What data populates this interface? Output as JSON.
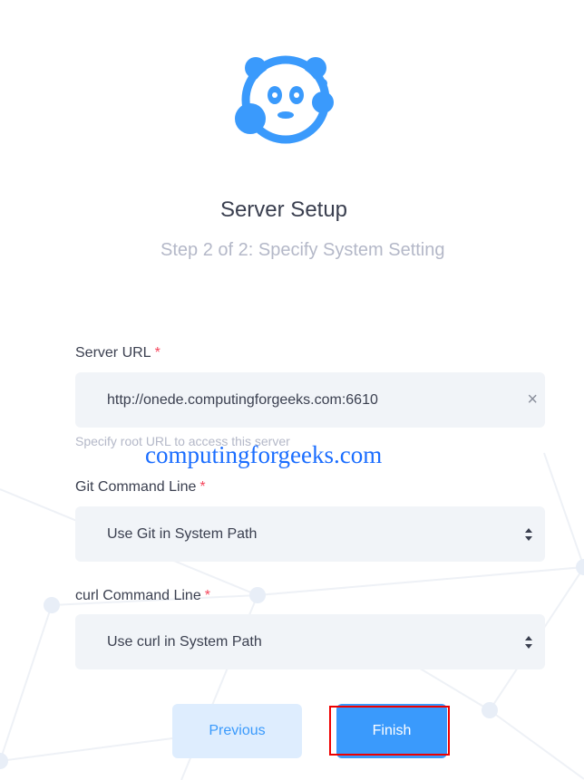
{
  "header": {
    "title": "Server Setup",
    "subtitle": "Step 2 of 2: Specify System Setting"
  },
  "form": {
    "server_url": {
      "label": "Server URL",
      "required_mark": "*",
      "value": "http://onede.computingforgeeks.com:6610",
      "hint": "Specify root URL to access this server",
      "clear_icon": "×"
    },
    "git": {
      "label": "Git Command Line",
      "required_mark": "*",
      "value": "Use Git in System Path"
    },
    "curl": {
      "label": "curl Command Line",
      "required_mark": "*",
      "value": "Use curl in System Path"
    }
  },
  "watermark": "computingforgeeks.com",
  "buttons": {
    "previous": "Previous",
    "finish": "Finish"
  },
  "colors": {
    "accent": "#3a9afc",
    "required": "#f5475d"
  }
}
